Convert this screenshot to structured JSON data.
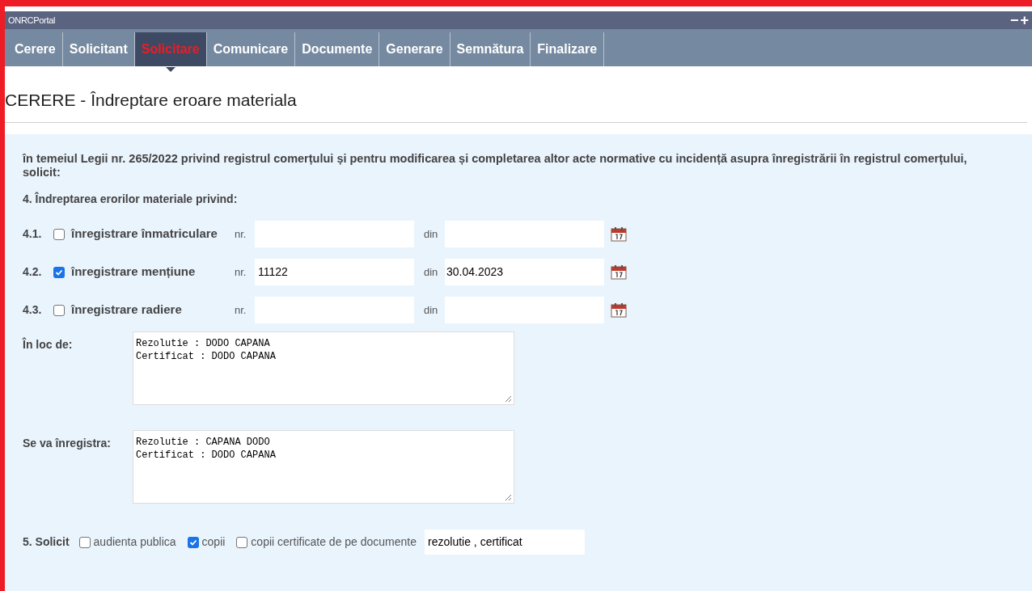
{
  "window": {
    "title": "ONRCPortal",
    "controls": [
      "−",
      "+"
    ]
  },
  "tabs": [
    {
      "label": "Cerere",
      "selected": false
    },
    {
      "label": "Solicitant",
      "selected": false
    },
    {
      "label": "Solicitare",
      "selected": true
    },
    {
      "label": "Comunicare",
      "selected": false
    },
    {
      "label": "Documente",
      "selected": false
    },
    {
      "label": "Generare",
      "selected": false
    },
    {
      "label": "Semnătura",
      "selected": false
    },
    {
      "label": "Finalizare",
      "selected": false
    }
  ],
  "page_title": "CERERE - Îndreptare eroare materiala",
  "intro": "în temeiul Legii nr. 265/2022 privind registrul comerțului și pentru modificarea și completarea altor acte normative cu incidență asupra înregistrării în registrul comerțului, solicit:",
  "section4": "4. Îndreptarea erorilor materiale privind:",
  "registrations": [
    {
      "number": "4.1.",
      "label": "înregistrare înmatriculare",
      "checked": false,
      "nr_label": "nr.",
      "din_label": "din"
    },
    {
      "number": "4.2.",
      "label": "înregistrare mențiune",
      "checked": true,
      "nr_label": "nr.",
      "nr": "11122",
      "din_label": "din",
      "date": "30.04.2023"
    },
    {
      "number": "4.3.",
      "label": "înregistrare radiere",
      "checked": false,
      "nr_label": "nr.",
      "din_label": "din"
    }
  ],
  "instead_of": {
    "label": "În loc de:",
    "value": "Rezolutie : DODO CAPANA\nCertificat : DODO CAPANA"
  },
  "will_register": {
    "label": "Se va înregistra:",
    "value": "Rezolutie : CAPANA DODO\nCertificat : DODO CAPANA"
  },
  "section5": {
    "label": "5. Solicit",
    "options": [
      {
        "label": "audienta publica",
        "checked": false
      },
      {
        "label": "copii",
        "checked": true
      },
      {
        "label": "copii certificate de pe documente",
        "checked": false
      }
    ],
    "documents": "rezolutie , certificat"
  }
}
